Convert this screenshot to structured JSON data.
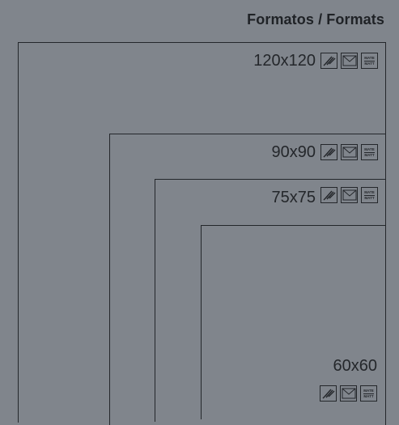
{
  "title": "Formatos / Formats",
  "formats": [
    {
      "label": "120x120"
    },
    {
      "label": "90x90"
    },
    {
      "label": "75x75"
    },
    {
      "label": "60x60"
    }
  ],
  "icons": {
    "pencil": "paint-brush-icon",
    "envelope": "envelope-icon",
    "mate_line1": "MATE",
    "mate_line2": "MATT"
  }
}
